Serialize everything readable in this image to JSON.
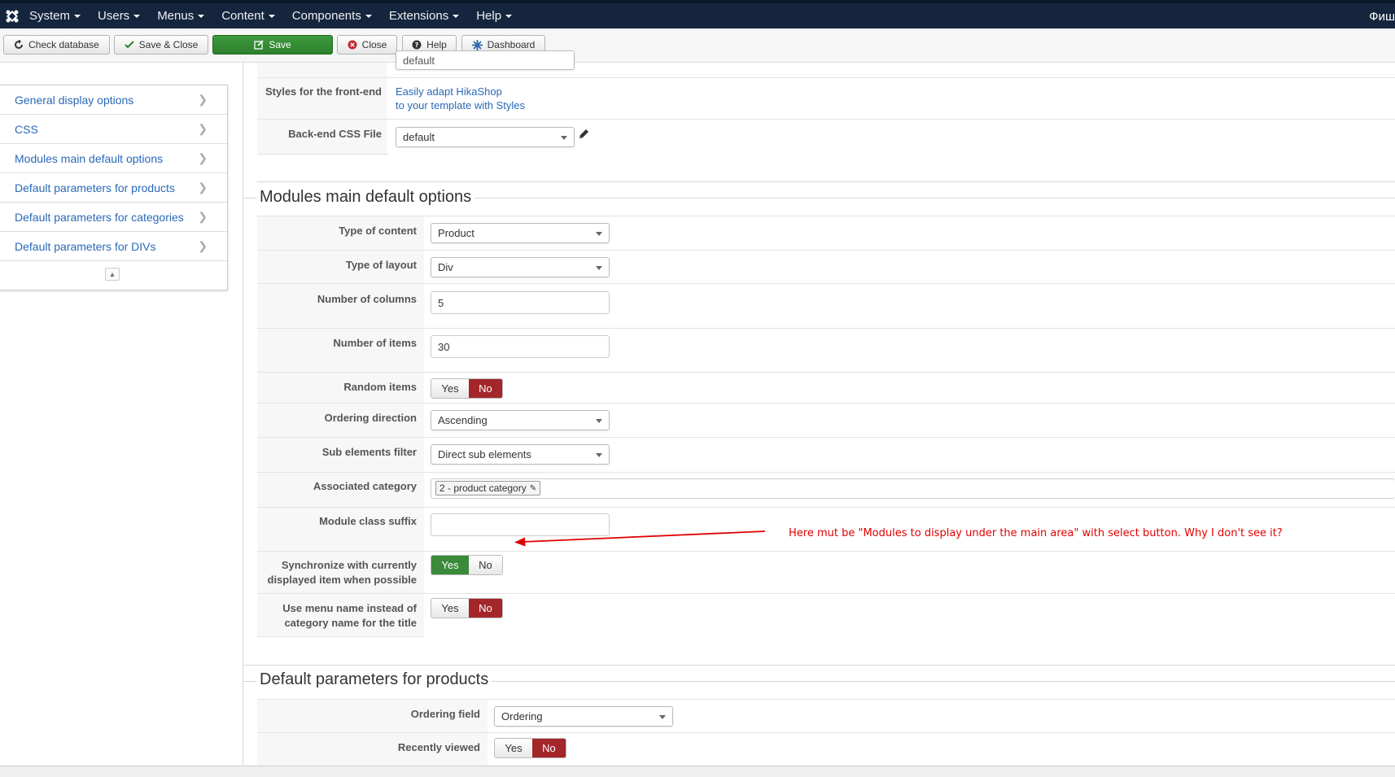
{
  "topnav": {
    "items": [
      "System",
      "Users",
      "Menus",
      "Content",
      "Components",
      "Extensions",
      "Help"
    ],
    "user_label": "Фиш"
  },
  "toolbar": {
    "check_database": "Check database",
    "save_close": "Save & Close",
    "save": "Save",
    "close": "Close",
    "help": "Help",
    "dashboard": "Dashboard"
  },
  "sidebar": {
    "items": [
      "General display options",
      "CSS",
      "Modules main default options",
      "Default parameters for products",
      "Default parameters for categories",
      "Default parameters for DIVs"
    ]
  },
  "css_section": {
    "partial_select_value": "default",
    "styles_label": "Styles for the front-end",
    "styles_link_line1": "Easily adapt HikaShop",
    "styles_link_line2": "to your template with Styles",
    "backend_css_label": "Back-end CSS File",
    "backend_css_value": "default"
  },
  "modules_section": {
    "title": "Modules main default options",
    "type_of_content_label": "Type of content",
    "type_of_content_value": "Product",
    "type_of_layout_label": "Type of layout",
    "type_of_layout_value": "Div",
    "columns_label": "Number of columns",
    "columns_value": "5",
    "items_label": "Number of items",
    "items_value": "30",
    "random_label": "Random items",
    "ordering_label": "Ordering direction",
    "ordering_value": "Ascending",
    "sub_filter_label": "Sub elements filter",
    "sub_filter_value": "Direct sub elements",
    "assoc_label": "Associated category",
    "assoc_value": "2 - product category",
    "suffix_label": "Module class suffix",
    "suffix_value": "",
    "sync_label_1": "Synchronize with currently",
    "sync_label_2": "displayed item when possible",
    "menu_name_label_1": "Use menu name instead of",
    "menu_name_label_2": "category name for the title",
    "yes": "Yes",
    "no": "No"
  },
  "products_section": {
    "title": "Default parameters for products",
    "ordering_field_label": "Ordering field",
    "ordering_field_value": "Ordering",
    "recently_viewed_label": "Recently viewed"
  },
  "annotation": {
    "text": "Here mut be \"Modules to display under the main area\" with select button. Why I don't see it?",
    "color": "#e00000"
  },
  "colors": {
    "nav_bg": "#14253d",
    "save_green": "#3d9b3d",
    "toggle_red": "#a3262b",
    "toggle_green": "#3a8a3a",
    "link_blue": "#2a69b8"
  }
}
